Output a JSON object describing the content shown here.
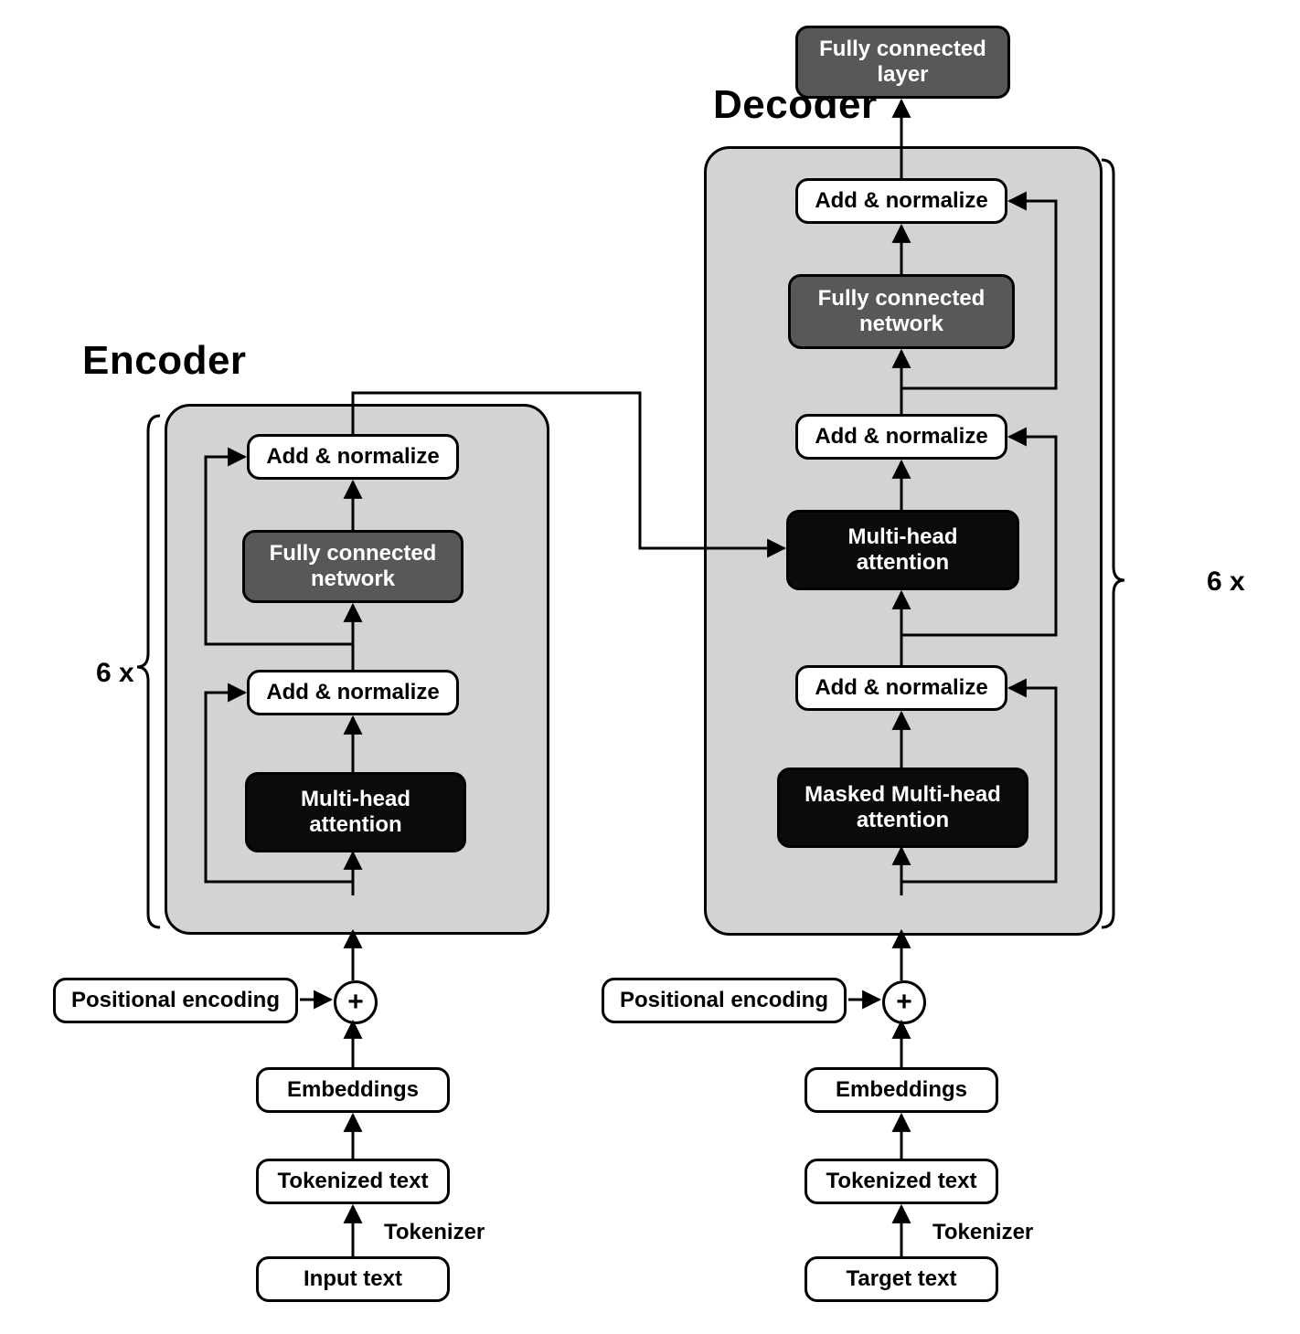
{
  "titles": {
    "encoder": "Encoder",
    "decoder": "Decoder",
    "enc_mult": "6 x",
    "dec_mult": "6 x"
  },
  "encoder": {
    "panel_boxes": {
      "addnorm_top": "Add & normalize",
      "fcn": "Fully connected\nnetwork",
      "addnorm_mid": "Add & normalize",
      "mha": "Multi-head\nattention"
    },
    "bottom": {
      "posenc": "Positional encoding",
      "embeddings": "Embeddings",
      "tokenized": "Tokenized text",
      "input_text": "Input text",
      "tokenizer_label": "Tokenizer"
    }
  },
  "decoder": {
    "panel_boxes": {
      "addnorm_top": "Add & normalize",
      "fcn": "Fully connected\nnetwork",
      "addnorm_mid": "Add & normalize",
      "mha": "Multi-head\nattention",
      "addnorm_low": "Add & normalize",
      "masked_mha": "Masked Multi-head\nattention"
    },
    "bottom": {
      "posenc": "Positional encoding",
      "embeddings": "Embeddings",
      "tokenized": "Tokenized text",
      "target_text": "Target text",
      "tokenizer_label": "Tokenizer"
    },
    "top_output": "Fully connected\nlayer"
  }
}
